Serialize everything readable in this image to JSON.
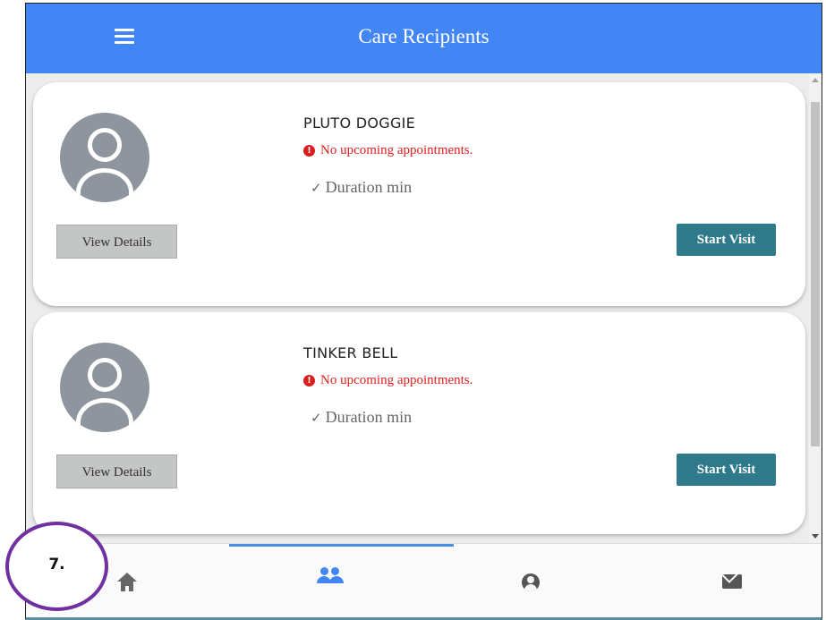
{
  "appbar": {
    "title": "Care Recipients",
    "menu_icon": "hamburger-menu-icon",
    "color": "#4285f4"
  },
  "recipients": [
    {
      "name": "PLUTO DOGGIE",
      "status": "No upcoming appointments.",
      "duration": "Duration min",
      "view_details_label": "View Details",
      "start_visit_label": "Start Visit"
    },
    {
      "name": "TINKER BELL",
      "status": "No upcoming appointments.",
      "duration": "Duration min",
      "view_details_label": "View Details",
      "start_visit_label": "Start Visit"
    }
  ],
  "bottom_nav": {
    "active": "people",
    "items": [
      {
        "id": "home",
        "icon": "home-icon"
      },
      {
        "id": "people",
        "icon": "people-icon"
      },
      {
        "id": "account",
        "icon": "account-circle-icon"
      },
      {
        "id": "mail",
        "icon": "mail-icon"
      }
    ]
  },
  "annotation": {
    "step_label": "7."
  },
  "colors": {
    "start_button": "#2e7a8a",
    "warning": "#e02020",
    "callout_border": "#7030a0"
  }
}
